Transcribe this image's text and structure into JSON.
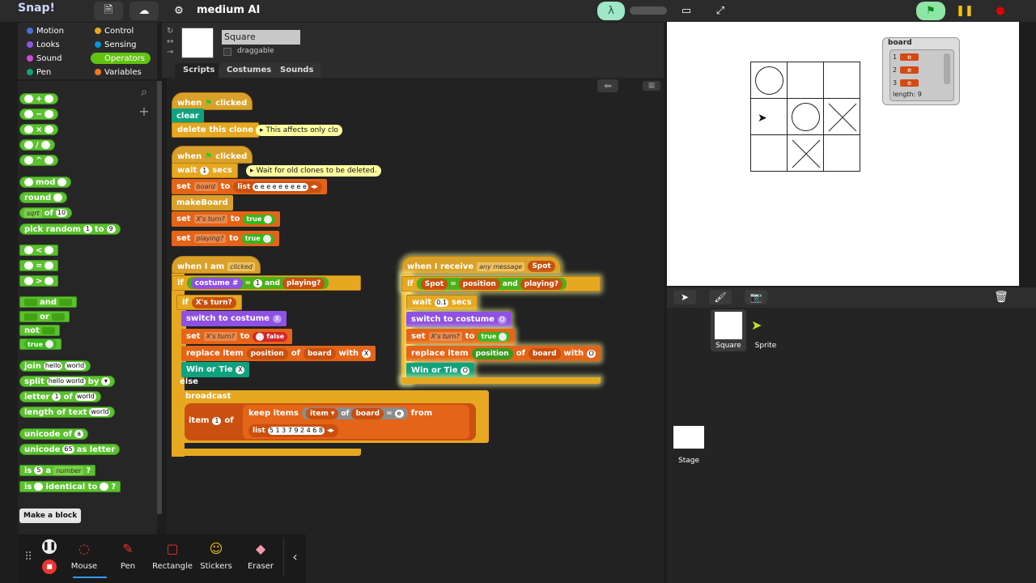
{
  "app": {
    "logo": "Snap!",
    "project_name": "medium AI"
  },
  "colors": {
    "motion": "#4a6cd4",
    "looks": "#8f56e3",
    "sound": "#cf4ad9",
    "pen": "#0fa27f",
    "control": "#e6a821",
    "sensing": "#0494dc",
    "operators": "#62c213",
    "variables": "#f3761d"
  },
  "categories": {
    "motion": "Motion",
    "looks": "Looks",
    "sound": "Sound",
    "pen": "Pen",
    "control": "Control",
    "sensing": "Sensing",
    "operators": "Operators",
    "variables": "Variables"
  },
  "palette": {
    "plus": "+",
    "minus": "−",
    "times": "×",
    "divide": "/",
    "power": "^",
    "mod": "mod",
    "round": "round",
    "sqrt": "sqrt",
    "of": "of",
    "sqrt_val": "10",
    "pick_random": "pick random",
    "pr_from": "1",
    "pr_to": "to",
    "pr_to_val": "9",
    "lt": "<",
    "eq": "=",
    "gt": ">",
    "and": "and",
    "or": "or",
    "not": "not",
    "true": "true",
    "join": "join",
    "join_a": "hello",
    "join_b": "world",
    "split": "split",
    "split_a": "hello world",
    "split_by": "by",
    "letter": "letter",
    "letter_n": "1",
    "letter_of": "of",
    "letter_w": "world",
    "length_of_text": "length of text",
    "length_w": "world",
    "unicode_of": "unicode of",
    "unicode_a": "a",
    "unicode_as": "unicode",
    "unicode_65": "65",
    "as_letter": "as letter",
    "is": "is",
    "is_5": "5",
    "is_a": "a",
    "is_number": "number",
    "q": "?",
    "identical_to": "identical to",
    "make_block": "Make a block"
  },
  "sprite": {
    "name": "Square",
    "draggable_label": "draggable",
    "tabs": [
      "Scripts",
      "Costumes",
      "Sounds"
    ]
  },
  "scripts": {
    "when": "when",
    "clicked": "clicked",
    "clear": "clear",
    "delete_clone": "delete this clone",
    "comment1": "This affects only clo",
    "wait": "wait",
    "wait_val": "1",
    "secs": "secs",
    "comment2": "Wait for old clones to be deleted.",
    "set": "set",
    "board_var": "board",
    "to": "to",
    "list": "list",
    "list_items": "e e e e e e e e e",
    "make_board": "makeBoard",
    "xs_turn_var": "X's turn?",
    "true": "true",
    "false": "false",
    "playing_var": "playing?",
    "when_i_am": "when I am",
    "clicked_dd": "clicked",
    "if": "if",
    "costume_num": "costume #",
    "eq": "=",
    "one": "1",
    "and": "and",
    "playing": "playing?",
    "xs_turn": "X's turn?",
    "switch_costume": "switch to costume",
    "cost_x": "X",
    "cost_o": "O",
    "replace_item": "replace item",
    "position": "position",
    "of": "of",
    "board": "board",
    "with": "with",
    "x_val": "X",
    "o_val": "O",
    "win_or_tie": "Win or Tie",
    "else": "else",
    "broadcast": "broadcast",
    "item": "item",
    "item_val": "1",
    "keep_items": "keep items",
    "from": "from",
    "list2": "list",
    "list2_items": "5 1 3 7 9 2 4 6 8",
    "e": "e",
    "when_receive": "when I receive",
    "any_message": "any message",
    "spot": "Spot",
    "wait2_val": "0.1"
  },
  "stage": {
    "watcher_title": "board",
    "watcher_rows": [
      {
        "i": "1",
        "v": "e"
      },
      {
        "i": "2",
        "v": "e"
      },
      {
        "i": "3",
        "v": "e"
      }
    ],
    "watcher_length": "length: 9"
  },
  "corral": {
    "sprites": [
      {
        "name": "Square"
      },
      {
        "name": "Sprite"
      }
    ],
    "stage_label": "Stage"
  },
  "tools": {
    "mouse": "Mouse",
    "pen": "Pen",
    "rectangle": "Rectangle",
    "stickers": "Stickers",
    "eraser": "Eraser"
  }
}
